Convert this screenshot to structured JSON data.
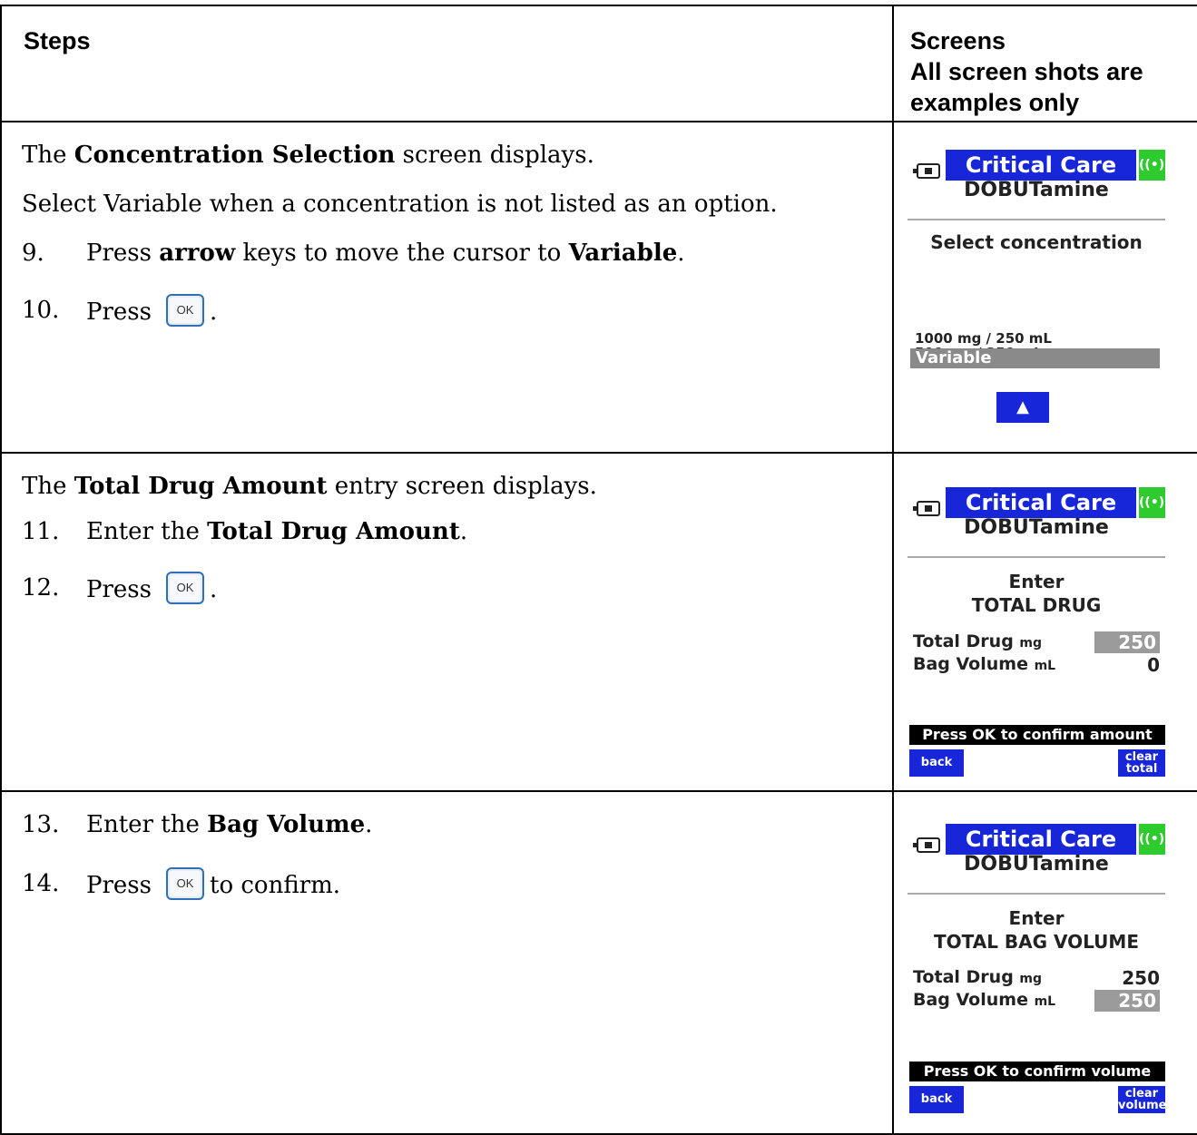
{
  "header": {
    "steps_label": "Steps",
    "screens_label": "Screens",
    "screens_note_line1": "All screen shots are",
    "screens_note_line2": "examples only"
  },
  "rows": [
    {
      "intro": {
        "pre": "The ",
        "bold": "Concentration Selection",
        "post": " screen displays."
      },
      "note": "Select Variable when a concentration is not listed as an option.",
      "steps": [
        {
          "num": "9.",
          "pre": "Press ",
          "bold": "arrow",
          "mid": " keys to move the cursor to ",
          "bold2": "Variable",
          "post": "."
        },
        {
          "num": "10.",
          "pre": "Press",
          "ok": "OK",
          "post": "."
        }
      ],
      "screen": {
        "mode": "Critical Care",
        "drug": "DOBUTamine",
        "title": "Select concentration",
        "options": [
          "1000 mg / 250 mL",
          "500 mg / 250 mL"
        ],
        "selected": "Variable",
        "arrow": "▲"
      }
    },
    {
      "intro": {
        "pre": "The ",
        "bold": "Total Drug Amount",
        "post": " entry screen displays."
      },
      "steps": [
        {
          "num": "11.",
          "pre": "Enter the ",
          "bold": "Total Drug Amount",
          "post": "."
        },
        {
          "num": "12.",
          "pre": "Press",
          "ok": "OK",
          "post": "."
        }
      ],
      "screen": {
        "mode": "Critical Care",
        "drug": "DOBUTamine",
        "title1": "Enter",
        "title2": "TOTAL DRUG",
        "field1_label": "Total Drug",
        "field1_unit": "mg",
        "field1_value": "250",
        "field2_label": "Bag Volume",
        "field2_unit": "mL",
        "field2_value": "0",
        "message": "Press OK to confirm amount",
        "left_key": "back",
        "right_key_1": "clear",
        "right_key_2": "total"
      }
    },
    {
      "steps": [
        {
          "num": "13.",
          "pre": "Enter the ",
          "bold": "Bag Volume",
          "post": "."
        },
        {
          "num": "14.",
          "pre": "Press",
          "ok": "OK",
          "post": "to confirm."
        }
      ],
      "screen": {
        "mode": "Critical Care",
        "drug": "DOBUTamine",
        "title1": "Enter",
        "title2": "TOTAL BAG VOLUME",
        "field1_label": "Total Drug",
        "field1_unit": "mg",
        "field1_value": "250",
        "field2_label": "Bag Volume",
        "field2_unit": "mL",
        "field2_value": "250",
        "message": "Press OK to confirm volume",
        "left_key": "back",
        "right_key_1": "clear",
        "right_key_2": "volume"
      }
    }
  ],
  "icons": {
    "battery": "battery-icon",
    "antenna": "wireless-antenna-icon",
    "ok": "ok-key-icon",
    "arrow": "up-arrow-icon"
  }
}
